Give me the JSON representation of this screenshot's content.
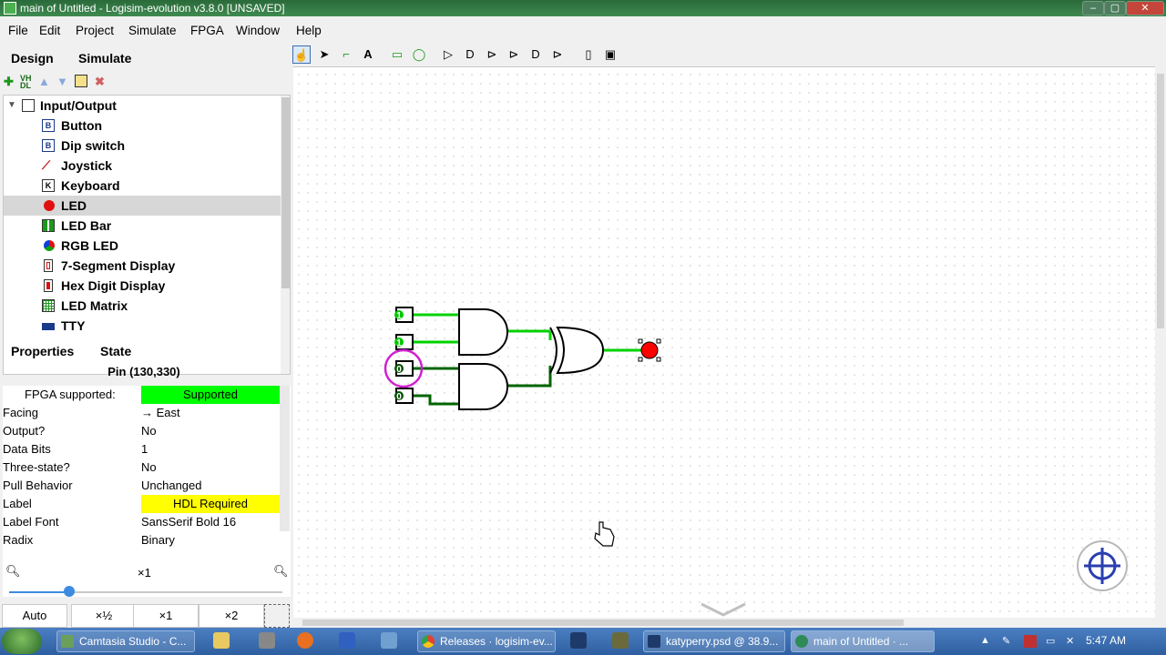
{
  "window": {
    "title": "main of Untitled - Logisim-evolution v3.8.0 [UNSAVED]",
    "min": "–",
    "max": "▢",
    "close": "✕"
  },
  "menu": [
    "File",
    "Edit",
    "Project",
    "Simulate",
    "FPGA",
    "Window",
    "Help"
  ],
  "left_tabs": [
    "Design",
    "Simulate"
  ],
  "tree": {
    "root": "Input/Output",
    "items": [
      {
        "label": "Button",
        "icon": "button-icon"
      },
      {
        "label": "Dip switch",
        "icon": "dip-switch-icon"
      },
      {
        "label": "Joystick",
        "icon": "joystick-icon"
      },
      {
        "label": "Keyboard",
        "icon": "keyboard-icon"
      },
      {
        "label": "LED",
        "icon": "led-icon",
        "selected": true
      },
      {
        "label": "LED Bar",
        "icon": "led-bar-icon"
      },
      {
        "label": "RGB LED",
        "icon": "rgb-led-icon"
      },
      {
        "label": "7-Segment Display",
        "icon": "seven-segment-icon"
      },
      {
        "label": "Hex Digit Display",
        "icon": "hex-digit-icon"
      },
      {
        "label": "LED Matrix",
        "icon": "led-matrix-icon"
      },
      {
        "label": "TTY",
        "icon": "tty-icon"
      }
    ]
  },
  "prop_tabs": [
    "Properties",
    "State"
  ],
  "props": {
    "title": "Pin (130,330)",
    "rows": [
      {
        "key": "FPGA supported:",
        "value": "Supported",
        "style": "green"
      },
      {
        "key": "Facing",
        "value": "→ East"
      },
      {
        "key": "Output?",
        "value": "No"
      },
      {
        "key": "Data Bits",
        "value": "1"
      },
      {
        "key": "Three-state?",
        "value": "No"
      },
      {
        "key": "Pull Behavior",
        "value": "Unchanged"
      },
      {
        "key": "Label",
        "value": "HDL Required",
        "style": "yellow"
      },
      {
        "key": "Label Font",
        "value": "SansSerif Bold 16"
      },
      {
        "key": "Radix",
        "value": "Binary"
      }
    ]
  },
  "zoom": {
    "level_label": "×1",
    "slider_fraction": 0.22,
    "buttons": [
      "Auto",
      "×½",
      "×1",
      "×2"
    ]
  },
  "circuit": {
    "pins": [
      "1",
      "1",
      "0",
      "0"
    ],
    "led_color": "#ff0000",
    "wire_high": "#00d200",
    "wire_low": "#006400"
  },
  "taskbar": {
    "tasks": [
      {
        "label": "Camtasia Studio - C...",
        "color": "#6aa05a"
      },
      {
        "label": "Releases · logisim-ev...",
        "color": "#e34133"
      },
      {
        "label": "katyperry.psd @ 38.9...",
        "color": "#1e3a6a"
      },
      {
        "label": "main of Untitled · ...",
        "color": "#2e8b57",
        "active": true
      }
    ],
    "clock": "5:47 AM"
  }
}
